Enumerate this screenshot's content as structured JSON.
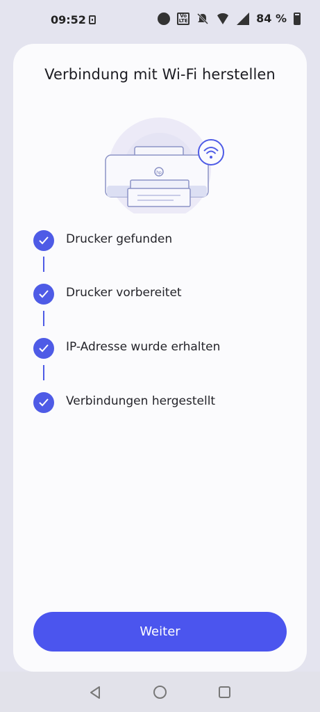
{
  "status_bar": {
    "time": "09:52",
    "battery_percent": "84 %",
    "icons": [
      "notification-icon",
      "alarm-icon",
      "volte-icon",
      "mute-icon",
      "wifi-icon",
      "signal-icon",
      "battery-icon"
    ]
  },
  "page": {
    "title": "Verbindung mit Wi-Fi herstellen",
    "printer_logo": "hp"
  },
  "steps": [
    {
      "label": "Drucker gefunden",
      "status": "done"
    },
    {
      "label": "Drucker vorbereitet",
      "status": "done"
    },
    {
      "label": "IP-Adresse wurde erhalten",
      "status": "done"
    },
    {
      "label": "Verbindungen hergestellt",
      "status": "done"
    }
  ],
  "actions": {
    "continue_label": "Weiter"
  },
  "colors": {
    "accent": "#4b55ee",
    "card": "#fbfbfd",
    "background": "#e4e4ef"
  }
}
